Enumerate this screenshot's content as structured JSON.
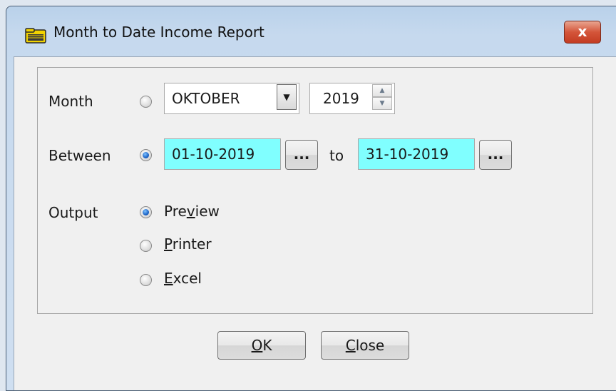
{
  "window": {
    "title": "Month to Date Income Report",
    "close_label": "x"
  },
  "form": {
    "month_label": "Month",
    "month_value": "OKTOBER",
    "year_value": "2019",
    "between_label": "Between",
    "from_date": "01-10-2019",
    "to_label": "to",
    "to_date": "31-10-2019",
    "date_picker_label": "...",
    "output_label": "Output",
    "output_options": [
      {
        "pre": "Pre",
        "underline": "v",
        "post": "iew",
        "checked": true
      },
      {
        "pre": "",
        "underline": "P",
        "post": "rinter",
        "checked": false
      },
      {
        "pre": "",
        "underline": "E",
        "post": "xcel",
        "checked": false
      }
    ],
    "month_mode_checked": false,
    "between_mode_checked": true
  },
  "buttons": {
    "ok": {
      "underline": "O",
      "post": "K"
    },
    "close": {
      "underline": "C",
      "post": "lose"
    }
  },
  "colors": {
    "date_field_bg": "#80ffff",
    "close_button": "#d4553a",
    "radio_selected": "#1b63c6"
  }
}
